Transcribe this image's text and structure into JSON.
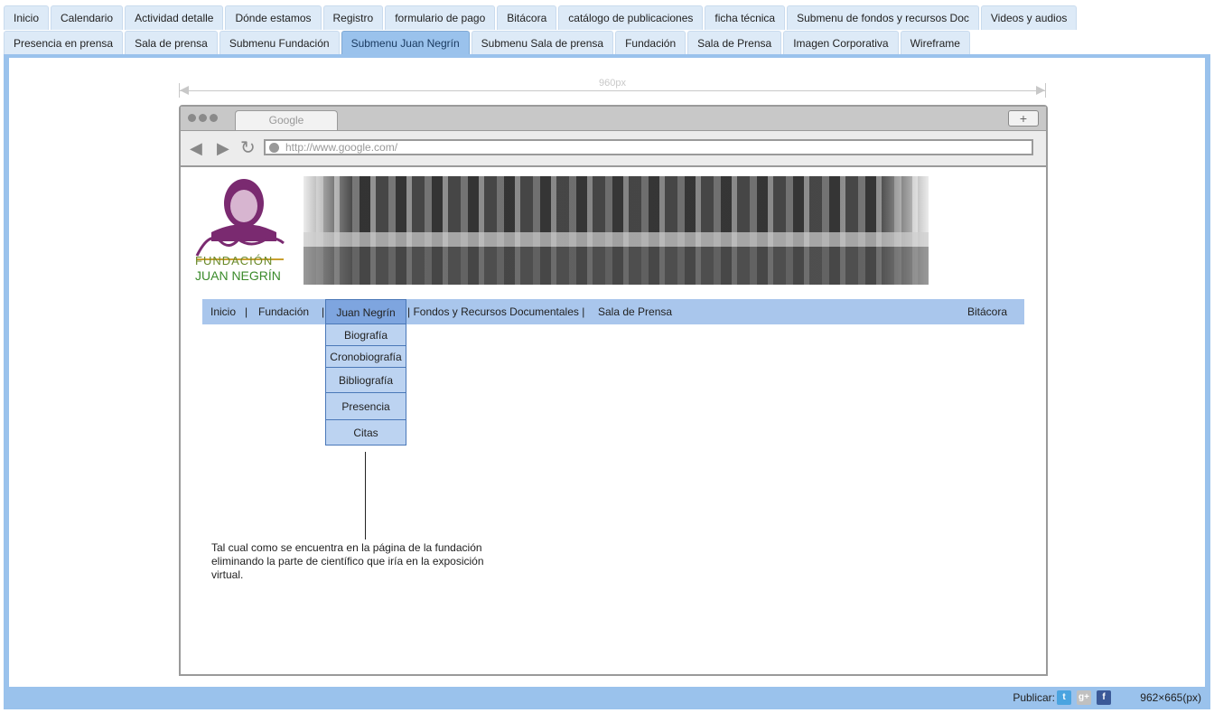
{
  "page_tabs_row1": [
    "Inicio",
    "Calendario",
    "Actividad detalle",
    "Dónde estamos",
    "Registro",
    "formulario de pago",
    "Bitácora",
    "catálogo de publicaciones",
    "ficha técnica",
    "Submenu de fondos y recursos Doc",
    "Videos y audios"
  ],
  "page_tabs_row2": [
    "Presencia en prensa",
    "Sala de prensa",
    "Submenu Fundación",
    "Submenu Juan Negrín",
    "Submenu Sala de prensa",
    "Fundación",
    "Sala de Prensa",
    "Imagen Corporativa",
    "Wireframe"
  ],
  "active_tab": "Submenu Juan Negrín",
  "ruler_label": "960px",
  "browser": {
    "tab_title": "Google",
    "new_tab": "+",
    "url": "http://www.google.com/"
  },
  "logo": {
    "line1": "FUNDACIÓN",
    "line2": "JUAN NEGRÍN"
  },
  "site_menu": {
    "inicio": "Inicio",
    "fundacion": "Fundación",
    "juan_negrin": "Juan Negrín",
    "fondos": "| Fondos y Recursos Documentales |",
    "sala": "Sala de Prensa",
    "bitacora": "Bitácora",
    "sep": "|"
  },
  "submenu": [
    "Biografía",
    "Cronobiografía",
    "Bibliografía",
    "Presencia",
    "Citas"
  ],
  "annotation": "Tal cual como se encuentra en la página de la fundación eliminando la parte de científico que iría en la exposición virtual.",
  "footer": {
    "publish": "Publicar:",
    "dimensions": "962×665(px)"
  },
  "colors": {
    "accent": "#9ac2ec",
    "menu": "#a9c6ec",
    "submenu": "#bcd3f1",
    "active_menu": "#7ea5df"
  }
}
